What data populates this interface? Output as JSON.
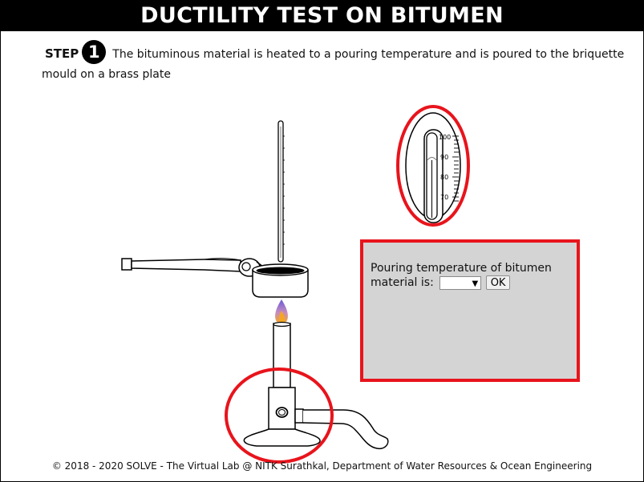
{
  "header": {
    "title": "DUCTILITY TEST ON BITUMEN"
  },
  "step": {
    "label": "STEP",
    "number": "1",
    "instruction": "The bituminous material is heated to a pouring temperature and is poured to the briquette mould on a brass plate"
  },
  "thermometer_zoom": {
    "scale_labels": [
      "100",
      "90",
      "80",
      "70"
    ]
  },
  "form": {
    "prompt": "Pouring temperature of bitumen material is:",
    "select_value": "",
    "ok_label": "OK"
  },
  "footer": {
    "text": "© 2018 - 2020 SOLVE - The Virtual Lab @ NITK Surathkal, Department of Water Resources & Ocean Engineering"
  },
  "colors": {
    "highlight": "#e8141c",
    "panel_bg": "#d4d4d4",
    "title_bg": "#000000",
    "flame_blue": "#5a5cd6",
    "flame_orange": "#f5a623"
  }
}
